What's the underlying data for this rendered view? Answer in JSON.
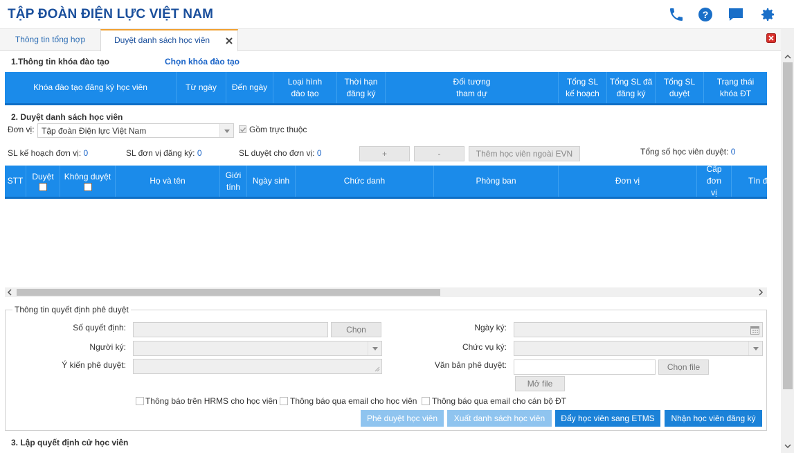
{
  "header": {
    "title": "TẬP ĐOÀN ĐIỆN LỰC VIỆT NAM",
    "icons": [
      "phone-icon",
      "help-icon",
      "chat-icon",
      "gear-icon"
    ]
  },
  "tabs": [
    {
      "label": "Thông tin tổng hợp"
    },
    {
      "label": "Duyệt danh sách học viên"
    }
  ],
  "section1": {
    "title": "1.Thông tin khóa đào tạo",
    "link": "Chọn khóa đào tạo",
    "columns": [
      "Khóa đào tạo đăng ký học viên",
      "Từ ngày",
      "Đến ngày",
      "Loại hình đào tạo",
      "Thời hạn đăng ký",
      "Đối tượng tham dự",
      "Tổng SL kế hoạch",
      "Tổng SL đã đăng ký",
      "Tổng SL duyệt",
      "Trạng thái khóa ĐT"
    ]
  },
  "section2": {
    "title": "2. Duyệt danh sách học viên",
    "unit_label": "Đơn vị:",
    "unit_value": "Tập đoàn Điện lực Việt Nam",
    "include_sub_label": "Gồm trực thuộc",
    "sl_plan_label": "SL kế hoạch đơn vị:",
    "sl_plan_value": "0",
    "sl_reg_label": "SL đơn vị đăng ký:",
    "sl_reg_value": "0",
    "sl_approved_label": "SL duyệt cho đơn vị:",
    "sl_approved_value": "0",
    "plus_label": "+",
    "minus_label": "-",
    "add_external_label": "Thêm học viên ngoài EVN",
    "total_label": "Tổng số học viên duyệt:",
    "total_value": "0",
    "columns": [
      "STT",
      "Duyệt",
      "Không duyệt",
      "Họ và tên",
      "Giới tính",
      "Ngày sinh",
      "Chức danh",
      "Phòng ban",
      "Đơn vị",
      "Cấp đơn vị",
      "Tìn đă"
    ]
  },
  "decision": {
    "legend": "Thông tin quyết định phê duyệt",
    "decision_no_label": "Số quyết định:",
    "choose_label": "Chọn",
    "signer_label": "Người ký:",
    "opinion_label": "Ý kiến phê duyệt:",
    "sign_date_label": "Ngày ký:",
    "position_label": "Chức vụ ký:",
    "doc_label": "Văn bản phê duyệt:",
    "choose_file_label": "Chọn file",
    "open_file_label": "Mở file",
    "notify_hrms": "Thông báo trên HRMS cho học viên",
    "notify_email_student": "Thông báo qua email cho học viên",
    "notify_email_staff": "Thông báo qua email cho cán bộ ĐT",
    "btn_approve": "Phê duyệt học viên",
    "btn_export": "Xuất danh sách học viên",
    "btn_push": "Đẩy học viên sang ETMS",
    "btn_receive": "Nhận học viên đăng ký"
  },
  "section3": {
    "title": "3. Lập quyết định cử học viên"
  },
  "colors": {
    "brand": "#1a4f9c",
    "grid_header": "#1b8bea",
    "link": "#1a64c8",
    "tab_accent": "#f0a030"
  }
}
